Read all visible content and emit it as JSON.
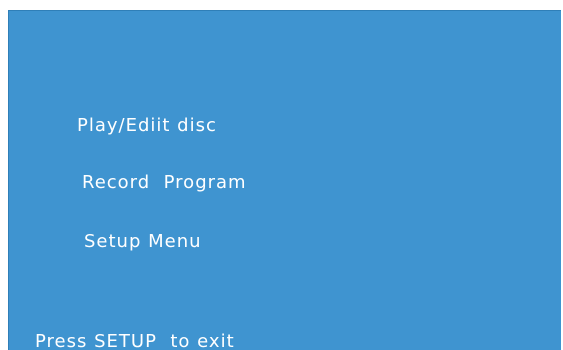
{
  "menu": {
    "items": [
      {
        "label": "Play/Ediit disc"
      },
      {
        "label": "Record  Program"
      },
      {
        "label": "Setup Menu"
      }
    ]
  },
  "footer": {
    "hint": "Press SETUP  to exit"
  },
  "colors": {
    "screen_background": "#3f94d0",
    "text": "#ffffff",
    "page_background": "#ffffff"
  }
}
